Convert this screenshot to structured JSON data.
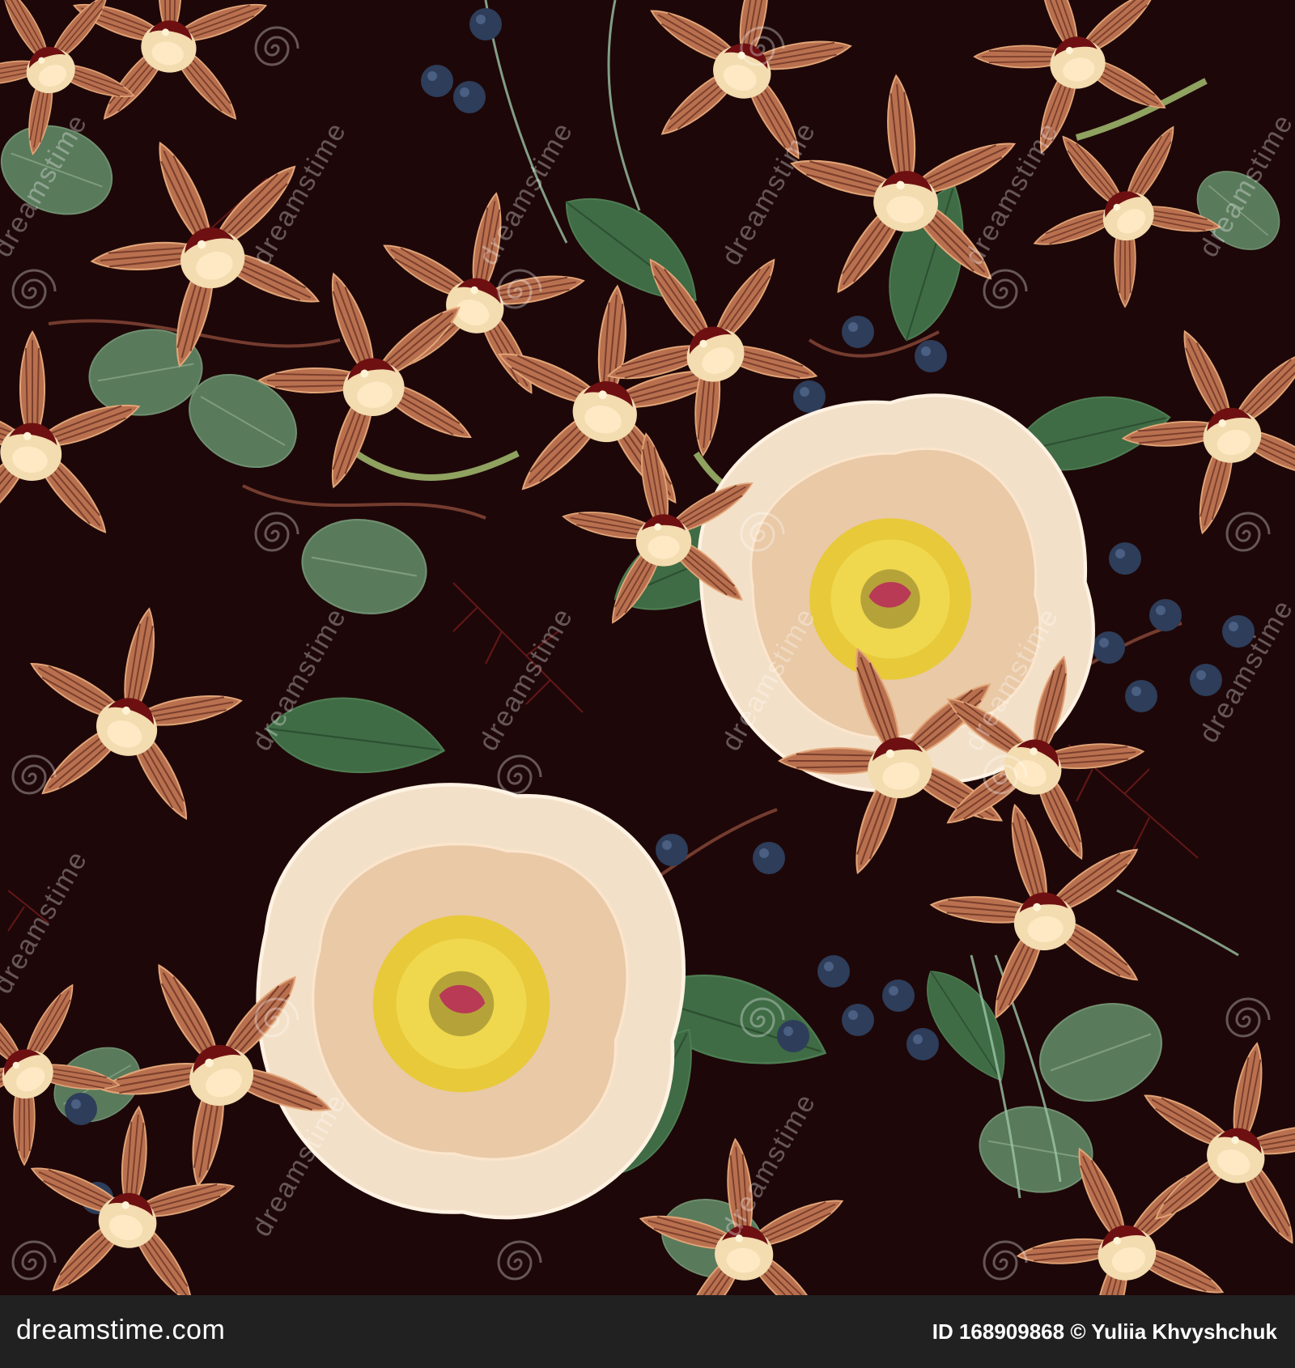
{
  "footer": {
    "logo_text": "dreamstime.com",
    "id_label": "ID",
    "id_value": "168909868",
    "credit": "© Yuliia Khvyshchuk"
  },
  "watermark": {
    "text": "dreamstime"
  },
  "colors": {
    "background": "#1e0708",
    "footer": "#212121",
    "orchid_petal": "#b8704f",
    "orchid_lip": "#f3dcb0",
    "orchid_throat": "#6e1012",
    "peony_petal": "#f0d6b8",
    "peony_center": "#e8c93a",
    "leaf": "#3f6b45",
    "eucalyptus": "#5a7a5c",
    "berry": "#2d3d5a"
  },
  "icons": [
    "dreamstime-spiral-icon"
  ]
}
